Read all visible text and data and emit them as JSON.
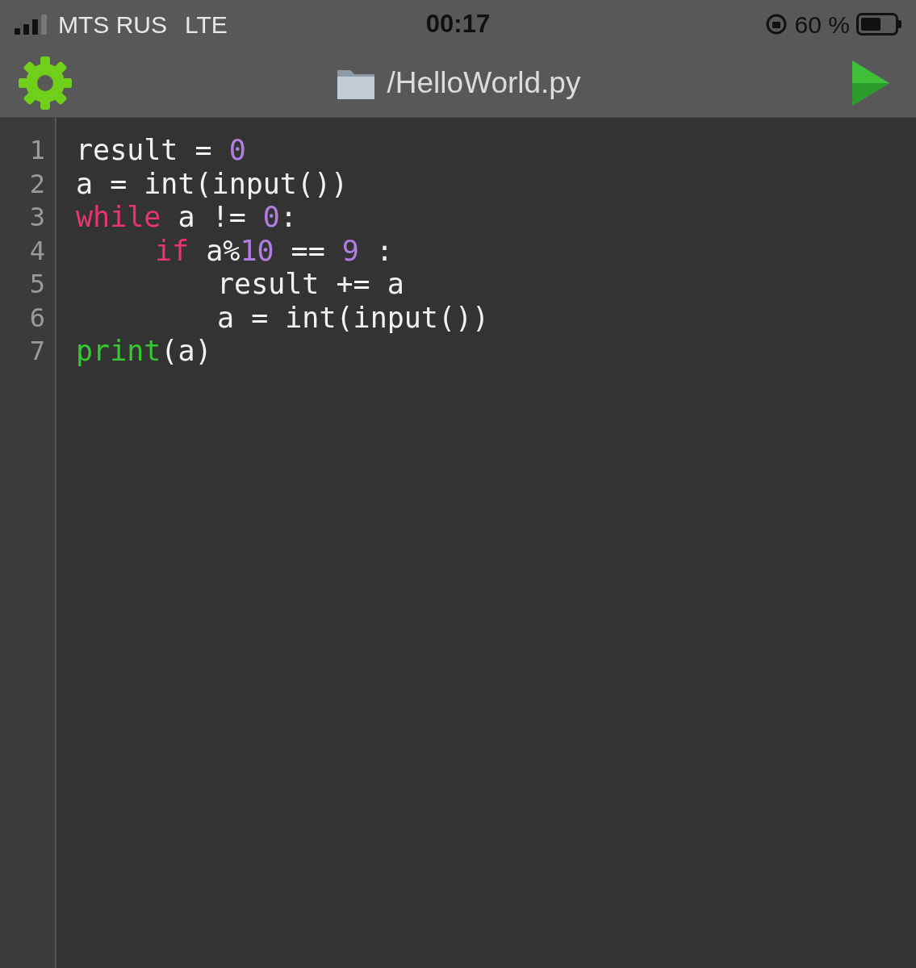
{
  "status_bar": {
    "carrier": "MTS RUS",
    "network": "LTE",
    "time": "00:17",
    "battery_percent": "60 %"
  },
  "toolbar": {
    "file_path": "/HelloWorld.py"
  },
  "editor": {
    "lines": [
      {
        "number": "1",
        "tokens": [
          {
            "kind": "plain",
            "text": "result = "
          },
          {
            "kind": "number",
            "text": "0"
          }
        ]
      },
      {
        "number": "2",
        "tokens": [
          {
            "kind": "plain",
            "text": "a = int(input())"
          }
        ]
      },
      {
        "number": "3",
        "tokens": [
          {
            "kind": "keyword",
            "text": "while"
          },
          {
            "kind": "plain",
            "text": " a != "
          },
          {
            "kind": "number",
            "text": "0"
          },
          {
            "kind": "plain",
            "text": ":"
          }
        ],
        "children": [
          {
            "number": "4",
            "tokens": [
              {
                "kind": "keyword",
                "text": "if"
              },
              {
                "kind": "plain",
                "text": " a%"
              },
              {
                "kind": "number",
                "text": "10"
              },
              {
                "kind": "plain",
                "text": " == "
              },
              {
                "kind": "number",
                "text": "9"
              },
              {
                "kind": "plain",
                "text": " :"
              }
            ],
            "children": [
              {
                "number": "5",
                "tokens": [
                  {
                    "kind": "plain",
                    "text": "result += a"
                  }
                ]
              },
              {
                "number": "6",
                "tokens": [
                  {
                    "kind": "plain",
                    "text": "a = int(input())"
                  }
                ]
              }
            ]
          }
        ]
      },
      {
        "number": "7",
        "tokens": [
          {
            "kind": "builtin",
            "text": "print"
          },
          {
            "kind": "plain",
            "text": "(a)"
          }
        ]
      }
    ]
  }
}
